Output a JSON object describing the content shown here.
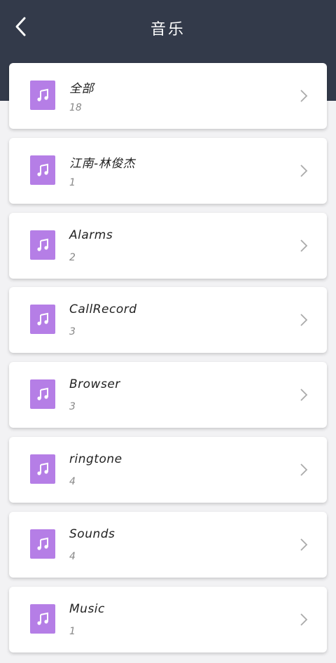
{
  "header": {
    "title": "音乐",
    "background_color": "#333a4a",
    "back_icon": "chevron-left-icon"
  },
  "accent_color": "#b57ee6",
  "folders": [
    {
      "name": "全部",
      "count": "18",
      "icon": "music-note-icon"
    },
    {
      "name": "江南-林俊杰",
      "count": "1",
      "icon": "music-note-icon"
    },
    {
      "name": "Alarms",
      "count": "2",
      "icon": "music-note-icon"
    },
    {
      "name": "CallRecord",
      "count": "3",
      "icon": "music-note-icon"
    },
    {
      "name": "Browser",
      "count": "3",
      "icon": "music-note-icon"
    },
    {
      "name": "ringtone",
      "count": "4",
      "icon": "music-note-icon"
    },
    {
      "name": "Sounds",
      "count": "4",
      "icon": "music-note-icon"
    },
    {
      "name": "Music",
      "count": "1",
      "icon": "music-note-icon"
    }
  ]
}
